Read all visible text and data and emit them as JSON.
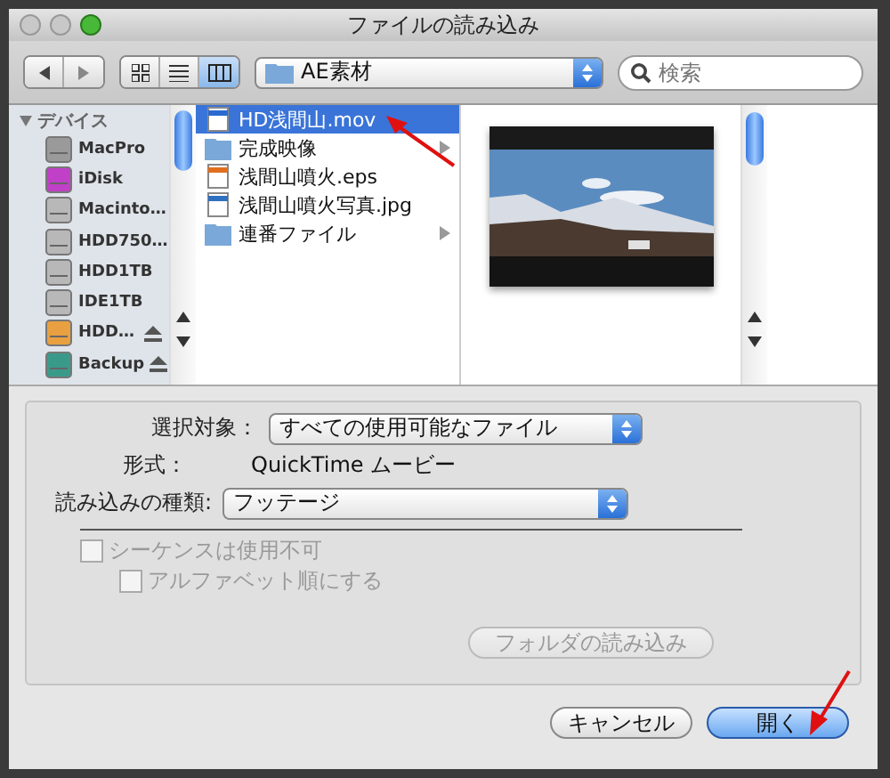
{
  "window": {
    "title": "ファイルの読み込み"
  },
  "toolbar": {
    "view_modes": [
      {
        "kind": "icons",
        "selected": false
      },
      {
        "kind": "list",
        "selected": false
      },
      {
        "kind": "columns",
        "selected": true
      }
    ],
    "location": "AE素材",
    "search": {
      "placeholder": "検索"
    }
  },
  "sidebar": {
    "heading": "デバイス",
    "items": [
      {
        "label": "MacPro",
        "kind": "computer"
      },
      {
        "label": "iDisk",
        "kind": "idisk"
      },
      {
        "label": "Macinto…",
        "kind": "disk"
      },
      {
        "label": "HDD750…",
        "kind": "disk"
      },
      {
        "label": "HDD1TB",
        "kind": "disk"
      },
      {
        "label": "IDE1TB",
        "kind": "disk"
      },
      {
        "label": "HDD…",
        "kind": "external"
      },
      {
        "label": "Backup",
        "kind": "backup"
      }
    ]
  },
  "files": [
    {
      "name": "HD浅間山.mov",
      "kind": "movie",
      "selected": true
    },
    {
      "name": "完成映像",
      "kind": "folder",
      "selected": false
    },
    {
      "name": "浅間山噴火.eps",
      "kind": "document",
      "selected": false
    },
    {
      "name": "浅間山噴火写真.jpg",
      "selected": false
    },
    {
      "name": "連番ファイル",
      "kind": "folder",
      "selected": false
    }
  ],
  "options": {
    "enable_label": "選択対象：",
    "enable_value": "すべての使用可能なファイル",
    "format_label": "形式：",
    "format_value": "QuickTime ムービー",
    "import_as_label": "読み込みの種類:",
    "import_as_value": "フッテージ",
    "checkboxes": [
      {
        "label": "シーケンスは使用不可",
        "checked": false,
        "disabled": true,
        "children": [
          {
            "label": "アルファベット順にする",
            "checked": false,
            "disabled": true
          }
        ]
      }
    ]
  },
  "import_folder_button": {
    "label": "フォルダの読み込み",
    "disabled": true
  },
  "buttons": [
    {
      "label": "キャンセル",
      "default": false
    },
    {
      "label": "開く",
      "default": true
    }
  ]
}
